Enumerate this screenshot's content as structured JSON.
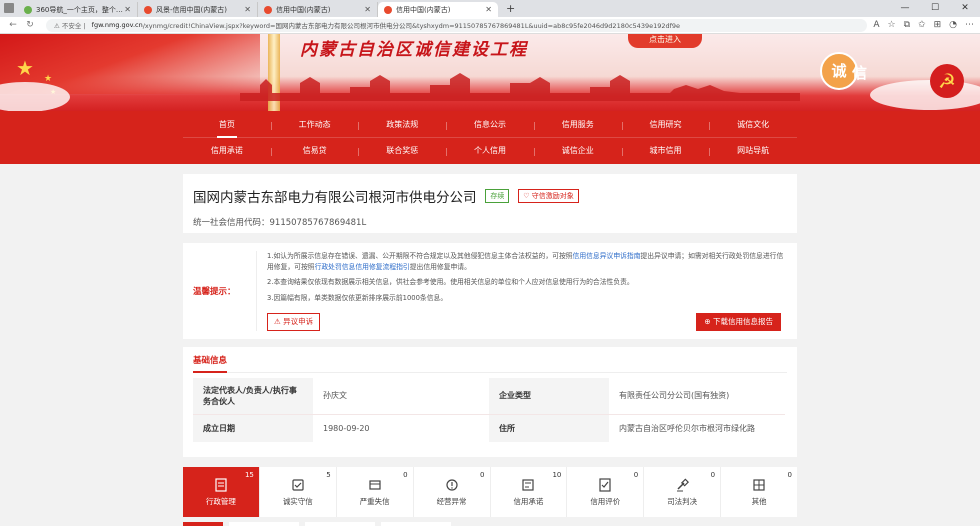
{
  "browser": {
    "tabs": [
      {
        "title": "360导航_一个主页，整个世界",
        "favicon_color": "#6ab04c"
      },
      {
        "title": "风景-信用中国(内蒙古)",
        "favicon_color": "#e84a2e"
      },
      {
        "title": "信用中国(内蒙古)",
        "favicon_color": "#e84a2e"
      },
      {
        "title": "信用中国(内蒙古)",
        "favicon_color": "#e84a2e",
        "active": true
      }
    ],
    "new_tab": "+",
    "security_label": "不安全",
    "url_host": "fgw.nmg.gov.cn",
    "url_path": "/xynmg/credit!ChinaView.jspx?keyword=国网内蒙古东部电力有限公司根河市供电分公司&tyshxydm=91150785767869481L&uuid=ab8c95fe2046d9d2180c5439e192df9e"
  },
  "banner": {
    "title": "内蒙古自治区诚信建设工程",
    "enter_button": "点击进入",
    "seal_char_1": "诚",
    "seal_char_2": "信"
  },
  "nav": {
    "row1": [
      "首页",
      "工作动态",
      "政策法规",
      "信息公示",
      "信用服务",
      "信用研究",
      "诚信文化"
    ],
    "row2": [
      "信用承诺",
      "信易贷",
      "联合奖惩",
      "个人信用",
      "诚信企业",
      "城市信用",
      "网站导航"
    ],
    "current": "首页"
  },
  "company": {
    "name": "国网内蒙古东部电力有限公司根河市供电分公司",
    "status_badge": "存续",
    "watch_badge": "守信激励对象",
    "code_label": "统一社会信用代码：",
    "code_value": "91150785767869481L"
  },
  "notice": {
    "label": "温馨提示：",
    "p1_a": "1.如认为所展示信息存在错误、遗漏、公开期限不符合规定以及其他侵犯信息主体合法权益的，可按照",
    "p1_link1": "信用信息异议申诉指南",
    "p1_b": "提出异议申请；如需对相关行政处罚信息进行信用修复，可按照",
    "p1_link2": "行政处罚信息信用修复流程指引",
    "p1_c": "提出信用修复申请。",
    "p2": "2.本查询结果仅依现有数据展示相关信息，供社会参考使用。使用相关信息的单位和个人应对信息使用行为的合法性负责。",
    "p3": "3.因篇幅有限，单类数据仅依更新排序展示前1000条信息。",
    "objection_button": "异议申诉",
    "report_button": "下载信用信息报告"
  },
  "basic_info": {
    "heading": "基础信息",
    "rows": [
      {
        "k1": "法定代表人/负责人/执行事务合伙人",
        "v1": "孙庆文",
        "k2": "企业类型",
        "v2": "有限责任公司分公司(国有独资)"
      },
      {
        "k1": "成立日期",
        "v1": "1980-09-20",
        "k2": "住所",
        "v2": "内蒙古自治区呼伦贝尔市根河市绿化路"
      }
    ]
  },
  "categories": [
    {
      "label": "行政管理",
      "count": "15",
      "icon": "admin-doc-icon",
      "active": true
    },
    {
      "label": "诚实守信",
      "count": "5",
      "icon": "honesty-icon"
    },
    {
      "label": "严重失信",
      "count": "0",
      "icon": "serious-default-icon"
    },
    {
      "label": "经营异常",
      "count": "0",
      "icon": "abnormal-operation-icon"
    },
    {
      "label": "信用承诺",
      "count": "10",
      "icon": "credit-commitment-icon"
    },
    {
      "label": "信用评价",
      "count": "0",
      "icon": "credit-evaluation-icon"
    },
    {
      "label": "司法判决",
      "count": "0",
      "icon": "judicial-icon"
    },
    {
      "label": "其他",
      "count": "0",
      "icon": "other-icon"
    }
  ],
  "colors": {
    "primary_red": "#d6231b",
    "link_blue": "#2a6ac8",
    "status_green": "#4aa13a"
  }
}
